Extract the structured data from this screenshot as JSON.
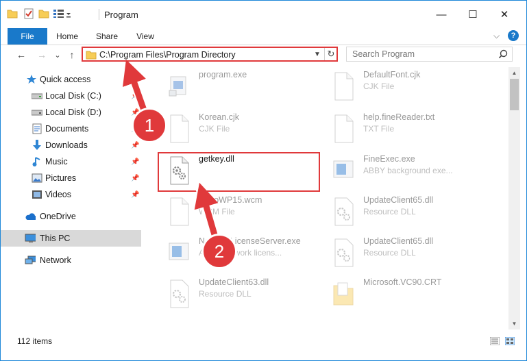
{
  "window": {
    "title": "Program",
    "controls": {
      "minimize": "—",
      "maximize": "☐",
      "close": "✕"
    }
  },
  "ribbon": {
    "tabs": [
      "File",
      "Home",
      "Share",
      "View"
    ],
    "help": "?",
    "collapse": "⌵"
  },
  "nav": {
    "back": "←",
    "forward": "→",
    "recent": "⌄",
    "up": "↑",
    "address": "C:\\Program Files\\Program Directory",
    "search_placeholder": "Search Program"
  },
  "sidebar": {
    "items": [
      {
        "label": "Quick access",
        "icon": "star-icon",
        "pinned": false
      },
      {
        "label": "Local Disk (C:)",
        "icon": "drive-icon",
        "pinned": true
      },
      {
        "label": "Local Disk (D:)",
        "icon": "drive-icon",
        "pinned": true
      },
      {
        "label": "Documents",
        "icon": "documents-icon",
        "pinned": true
      },
      {
        "label": "Downloads",
        "icon": "downloads-icon",
        "pinned": true
      },
      {
        "label": "Music",
        "icon": "music-icon",
        "pinned": true
      },
      {
        "label": "Pictures",
        "icon": "pictures-icon",
        "pinned": true
      },
      {
        "label": "Videos",
        "icon": "videos-icon",
        "pinned": true
      },
      {
        "label": "OneDrive",
        "icon": "cloud-icon",
        "pinned": false
      },
      {
        "label": "This PC",
        "icon": "pc-icon",
        "pinned": false
      },
      {
        "label": "Network",
        "icon": "network-icon",
        "pinned": false
      }
    ]
  },
  "files": [
    {
      "name": "program.exe",
      "type": "",
      "icon": "exe-icon"
    },
    {
      "name": "DefaultFont.cjk",
      "type": "CJK File",
      "icon": "file-icon"
    },
    {
      "name": "Korean.cjk",
      "type": "CJK File",
      "icon": "file-icon"
    },
    {
      "name": "help.fineReader.txt",
      "type": "TXT File",
      "icon": "file-icon"
    },
    {
      "name": "getkey.dll",
      "type": "",
      "icon": "dll-icon"
    },
    {
      "name": "FineExec.exe",
      "type": "ABBY background exe...",
      "icon": "exe-icon"
    },
    {
      "name": "ExtroWP15.wcm",
      "type": "WCM File",
      "icon": "file-icon"
    },
    {
      "name": "UpdateClient65.dll",
      "type": "Resource DLL",
      "icon": "dll-icon"
    },
    {
      "name": "NetworkLicenseServer.exe",
      "type": "ABBY network licens...",
      "icon": "exe-icon"
    },
    {
      "name": "UpdateClient65.dll",
      "type": "Resource DLL",
      "icon": "dll-icon"
    },
    {
      "name": "UpdateClient63.dll",
      "type": "Resource DLL",
      "icon": "dll-icon"
    },
    {
      "name": "Microsoft.VC90.CRT",
      "type": "",
      "icon": "folder-icon"
    }
  ],
  "status": {
    "item_count": "112 items"
  },
  "annotations": {
    "step1": "1",
    "step2": "2"
  },
  "colors": {
    "accent": "#1979ca",
    "highlight": "#e0393b",
    "selected": "#cce8ff"
  }
}
